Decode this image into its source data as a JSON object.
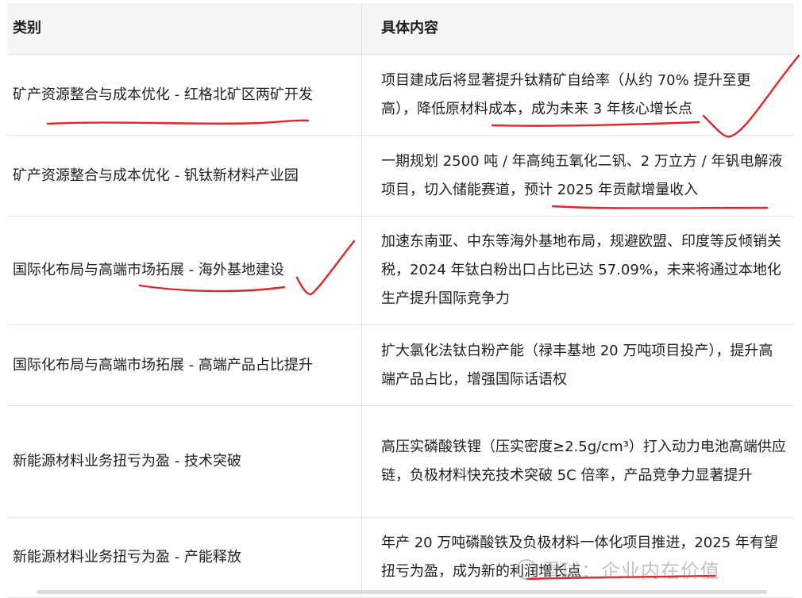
{
  "table": {
    "headers": {
      "category": "类别",
      "content": "具体内容"
    },
    "rows": [
      {
        "category": "矿产资源整合与成本优化 - 红格北矿区两矿开发",
        "content": "项目建成后将显著提升钛精矿自给率（从约 70% 提升至更高），降低原材料成本，成为未来 3 年核心增长点"
      },
      {
        "category": "矿产资源整合与成本优化 - 钒钛新材料产业园",
        "content": "一期规划 2500 吨 / 年高纯五氧化二钒、2 万立方 / 年钒电解液项目，切入储能赛道，预计 2025 年贡献增量收入"
      },
      {
        "category": "国际化布局与高端市场拓展 - 海外基地建设",
        "content": "加速东南亚、中东等海外基地布局，规避欧盟、印度等反倾销关税，2024 年钛白粉出口占比已达 57.09%，未来将通过本地化生产提升国际竞争力"
      },
      {
        "category": "国际化布局与高端市场拓展 - 高端产品占比提升",
        "content": "扩大氯化法钛白粉产能（禄丰基地 20 万吨项目投产），提升高端产品占比，增强国际话语权"
      },
      {
        "category": "新能源材料业务扭亏为盈 - 技术突破",
        "content": "高压实磷酸铁锂（压实密度≥2.5g/cm³）打入动力电池高端供应链，负极材料快充技术突破 5C 倍率，产品竞争力显著提升"
      },
      {
        "category": "新能源材料业务扭亏为盈 - 产能释放",
        "content": "年产 20 万吨磷酸铁及负极材料一体化项目推进，2025 年有望扭亏为盈，成为新的利润增长点"
      }
    ]
  },
  "watermark": {
    "text": "雪球：企业内在价值",
    "icon": "snowball-logo-icon"
  },
  "annotation_color": "#e8232a"
}
